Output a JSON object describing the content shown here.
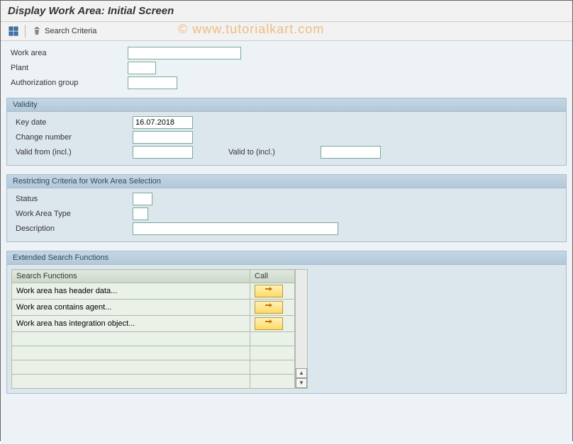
{
  "title": "Display Work Area: Initial Screen",
  "watermark": "© www.tutorialkart.com",
  "toolbar": {
    "search_criteria_label": "Search Criteria"
  },
  "top_fields": {
    "work_area_label": "Work area",
    "work_area_value": "",
    "plant_label": "Plant",
    "plant_value": "",
    "auth_group_label": "Authorization group",
    "auth_group_value": ""
  },
  "validity": {
    "header": "Validity",
    "key_date_label": "Key date",
    "key_date_value": "16.07.2018",
    "change_number_label": "Change number",
    "change_number_value": "",
    "valid_from_label": "Valid from (incl.)",
    "valid_from_value": "",
    "valid_to_label": "Valid to (incl.)",
    "valid_to_value": ""
  },
  "restrict": {
    "header": "Restricting Criteria for Work Area Selection",
    "status_label": "Status",
    "status_value": "",
    "type_label": "Work Area Type",
    "type_value": "",
    "desc_label": "Description",
    "desc_value": ""
  },
  "extended": {
    "header": "Extended Search Functions",
    "col_search": "Search Functions",
    "col_call": "Call",
    "rows": [
      {
        "label": "Work area has header data..."
      },
      {
        "label": "Work area contains agent..."
      },
      {
        "label": "Work area has integration object..."
      }
    ]
  }
}
